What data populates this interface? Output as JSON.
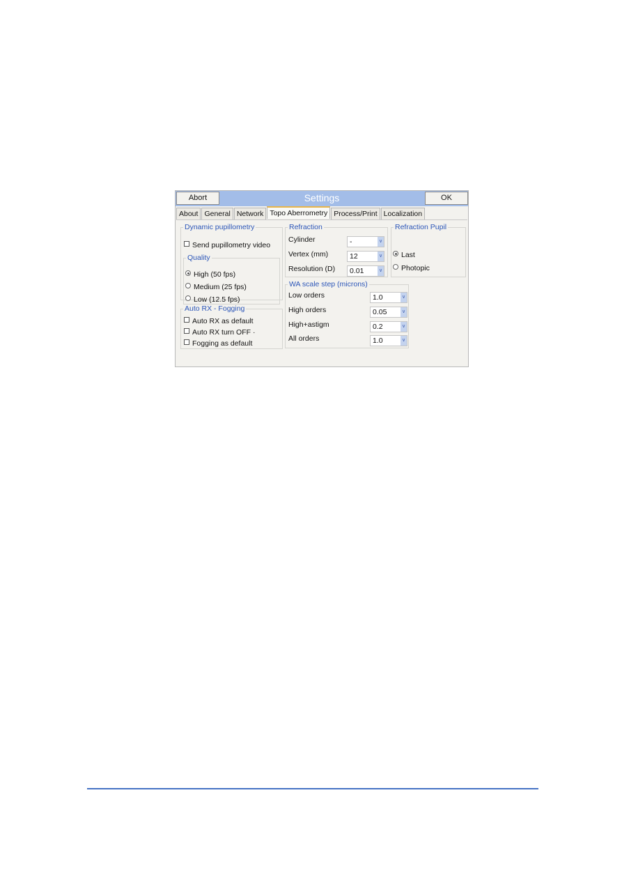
{
  "dialog": {
    "title": "Settings",
    "abort_label": "Abort",
    "ok_label": "OK",
    "tabs": [
      {
        "label": "About"
      },
      {
        "label": "General"
      },
      {
        "label": "Network"
      },
      {
        "label": "Topo Aberrometry",
        "active": true
      },
      {
        "label": "Process/Print"
      },
      {
        "label": "Localization"
      }
    ]
  },
  "dynamic_pupillometry": {
    "title": "Dynamic pupillometry",
    "send_video_label": "Send pupillometry video",
    "send_video_checked": false,
    "quality": {
      "title": "Quality",
      "options": [
        {
          "label": "High (50 fps)",
          "selected": true
        },
        {
          "label": "Medium (25 fps)",
          "selected": false
        },
        {
          "label": "Low (12.5 fps)",
          "selected": false
        }
      ]
    }
  },
  "auto_rx_fogging": {
    "title": "Auto RX -  Fogging",
    "options": [
      {
        "label": "Auto RX as default",
        "checked": false
      },
      {
        "label": "Auto RX turn OFF ·",
        "checked": false
      },
      {
        "label": "Fogging as default",
        "checked": false
      }
    ]
  },
  "refraction": {
    "title": "Refraction",
    "fields": [
      {
        "label": "Cylinder",
        "value": "-"
      },
      {
        "label": "Vertex (mm)",
        "value": "12"
      },
      {
        "label": "Resolution (D)",
        "value": "0.01"
      }
    ]
  },
  "refraction_pupil": {
    "title": "Refraction Pupil",
    "options": [
      {
        "label": "Last",
        "selected": true
      },
      {
        "label": "Photopic",
        "selected": false
      }
    ]
  },
  "wa_scale_step": {
    "title": "WA scale step (microns)",
    "fields": [
      {
        "label": "Low orders",
        "value": "1.0"
      },
      {
        "label": "High orders",
        "value": "0.05"
      },
      {
        "label": "High+astigm",
        "value": "0.2"
      },
      {
        "label": "All orders",
        "value": "1.0"
      }
    ]
  },
  "colors": {
    "title_bar": "#a3bde8",
    "group_title": "#2b55b8",
    "footer_rule": "#4472c4"
  }
}
